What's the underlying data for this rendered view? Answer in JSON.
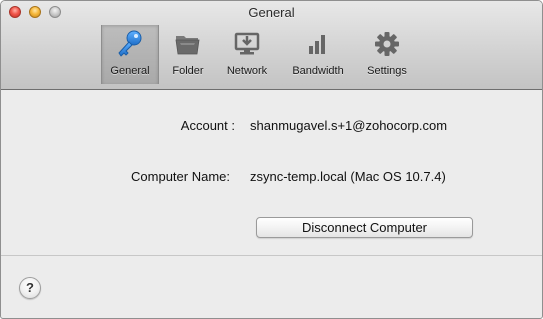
{
  "window": {
    "title": "General"
  },
  "toolbar": {
    "items": [
      {
        "label": "General",
        "icon": "key-icon",
        "selected": true
      },
      {
        "label": "Folder",
        "icon": "folder-icon",
        "selected": false
      },
      {
        "label": "Network",
        "icon": "network-icon",
        "selected": false
      },
      {
        "label": "Bandwidth",
        "icon": "bandwidth-icon",
        "selected": false
      },
      {
        "label": "Settings",
        "icon": "gear-icon",
        "selected": false
      }
    ]
  },
  "general": {
    "account_label": "Account :",
    "account_value": "shanmugavel.s+1@zohocorp.com",
    "computer_label": "Computer Name:",
    "computer_value": "zsync-temp.local (Mac OS 10.7.4)",
    "disconnect_label": "Disconnect Computer"
  },
  "help": {
    "label": "?"
  },
  "colors": {
    "key_icon": "#2f86e0",
    "toolbar_icon": "#6a6a6a",
    "selected_tab": "#b2b2b2"
  }
}
